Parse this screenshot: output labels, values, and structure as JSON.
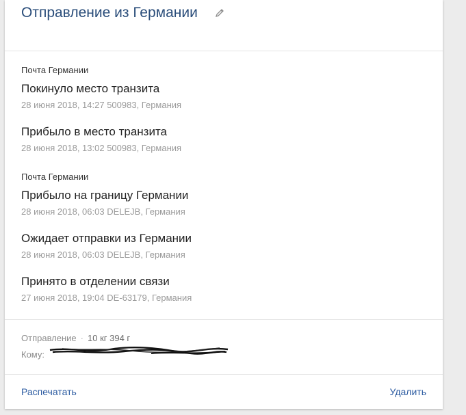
{
  "header": {
    "title": "Отправление из Германии",
    "edit_icon": "pencil-icon"
  },
  "events": [
    {
      "source": "Почта Германии",
      "status": "Покинуло место транзита",
      "meta": "28 июня 2018, 14:27 500983, Германия"
    },
    {
      "source": "",
      "status": "Прибыло в место транзита",
      "meta": "28 июня 2018, 13:02 500983, Германия"
    },
    {
      "source": "Почта Германии",
      "status": "Прибыло на границу Германии",
      "meta": "28 июня 2018, 06:03 DELEJB, Германия"
    },
    {
      "source": "",
      "status": "Ожидает отправки из Германии",
      "meta": "28 июня 2018, 06:03 DELEJB, Германия"
    },
    {
      "source": "",
      "status": "Принято в отделении связи",
      "meta": "27 июня 2018, 19:04 DE-63179, Германия"
    }
  ],
  "info": {
    "type_label": "Отправление",
    "separator": "·",
    "weight": "10 кг 394 г",
    "recipient_label": "Кому:"
  },
  "footer": {
    "print_label": "Распечатать",
    "delete_label": "Удалить"
  }
}
